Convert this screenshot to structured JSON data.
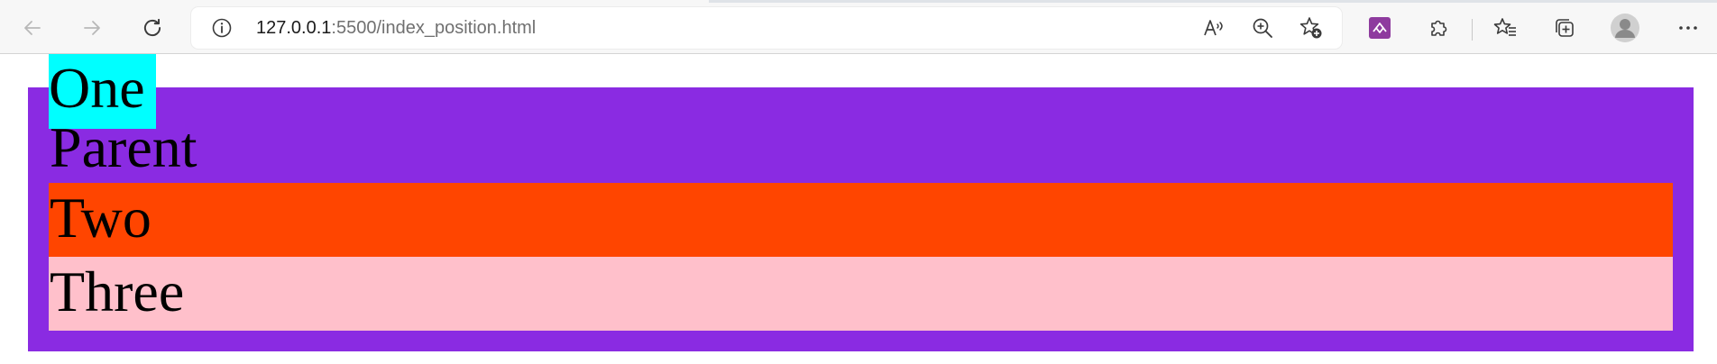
{
  "browser": {
    "url_host": "127.0.0.1",
    "url_rest": ":5500/index_position.html",
    "colors": {
      "chrome_bg": "#f7f7f7",
      "icon": "#3b3b3b",
      "icon_disabled": "#b8b8b8",
      "extension": "#8e3b9e"
    },
    "icons": [
      "back-icon",
      "forward-icon",
      "refresh-icon",
      "site-info-icon",
      "read-aloud-icon",
      "zoom-icon",
      "add-favorite-icon",
      "extension-icon",
      "extensions-puzzle-icon",
      "favorites-icon",
      "collections-icon",
      "profile-avatar-icon",
      "more-options-icon"
    ]
  },
  "page": {
    "one": "One",
    "parent": "Parent",
    "two": "Two",
    "three": "Three",
    "colors": {
      "parent": "#8a2be2",
      "one": "#00ffff",
      "two": "#ff4500",
      "three": "#ffc0cb"
    }
  }
}
